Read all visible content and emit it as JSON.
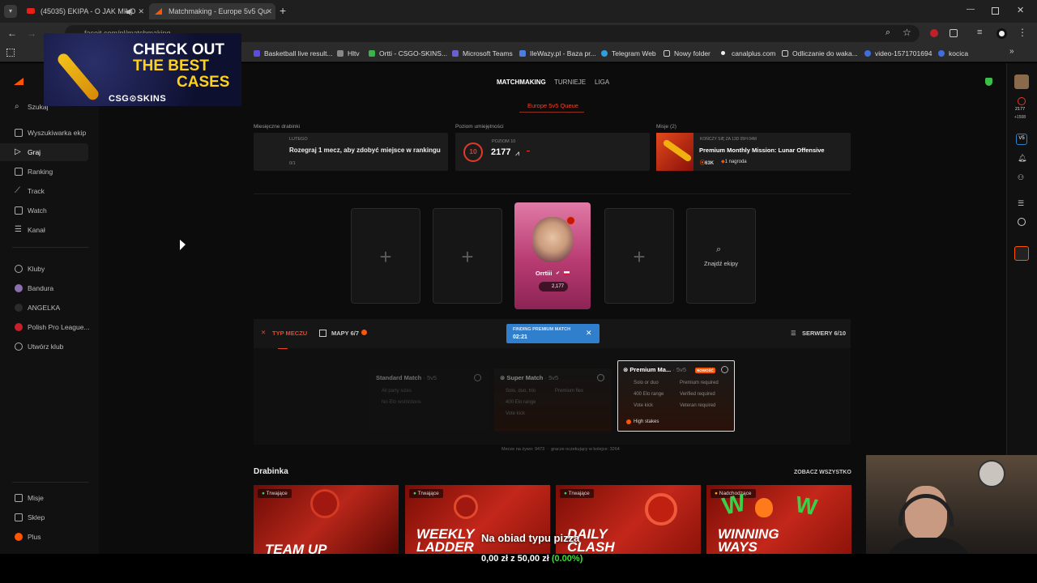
{
  "tabs": [
    {
      "label": "(45035) EKIPA - O JAK MIŁO"
    },
    {
      "label": "Matchmaking - Europe 5v5 Qu"
    }
  ],
  "address": "faceit.com/pl/matchmaking",
  "bookmarks": [
    "Basketball live result...",
    "Hltv",
    "Ortti - CSGO-SKINS...",
    "Microsoft Teams",
    "IleWazy.pl - Baza pr...",
    "Telegram Web",
    "Nowy folder",
    "canalplus.com",
    "Odliczanie do waka...",
    "video-1571701694",
    "kocica"
  ],
  "ad": {
    "line1": "CHECK OUT",
    "line2": "THE BEST",
    "line3": "CASES",
    "brand": "CSG⊙SKINS"
  },
  "nav": {
    "search": "Szukaj",
    "items": [
      "Wyszukiwarka ekip",
      "Graj",
      "Ranking",
      "Track",
      "Watch",
      "Kanał"
    ],
    "clubs": [
      "Kluby",
      "Bandura",
      "ANGELKA",
      "Polish Pro League...",
      "Utwórz klub"
    ],
    "bottom": [
      "Misje",
      "Sklep",
      "Plus"
    ]
  },
  "topnav": {
    "tabs": [
      "MATCHMAKING",
      "TURNIEJE",
      "LIGA"
    ],
    "queue": "Europe 5v5 Queue"
  },
  "cards": {
    "ladder": {
      "header": "Miesięczne drabinki",
      "sub": "LUTEGO",
      "title": "Rozegraj 1 mecz, aby zdobyć miejsce w rankingu",
      "progress": "0/1"
    },
    "skill": {
      "header": "Poziom umiejętności",
      "level_label": "POZIOM 10",
      "level": "10",
      "elo": "2177"
    },
    "mission": {
      "header": "Misje (2)",
      "sub": "KOŃCZY SIĘ ZA 13D 05H 04M",
      "title": "Premium Monthly Mission: Lunar Offensive",
      "points": "63K",
      "reward": "1 nagroda"
    }
  },
  "lobby": {
    "player_name": "Orrtiii",
    "player_elo": "2,177",
    "find_teams": "Znajdź ekipy"
  },
  "options": {
    "match_type": "TYP MECZU",
    "maps": "MAPY 6/7",
    "servers": "SERWERY 6/10",
    "finding_label": "FINDING PREMIUM MATCH",
    "finding_time": "02:21"
  },
  "modes": [
    {
      "title": "Standard Match",
      "tag": "5v5",
      "features": [
        "All party sizes",
        "No Elo restrictions"
      ]
    },
    {
      "title": "Super Match",
      "tag": "5v5",
      "features": [
        "Solo, duo, trio",
        "Premium flex",
        "400 Elo range",
        "Vote kick"
      ]
    },
    {
      "title": "Premium Ma...",
      "tag": "5v5",
      "badge": "NOWOŚĆ",
      "features": [
        "Solo or duo",
        "Premium required",
        "400 Elo range",
        "Verified required",
        "Vote kick",
        "Veteran required"
      ],
      "highlight": "High stakes"
    }
  ],
  "stats": "Mecze na żywo: 9473  ·  gracze oczekujący w kolejce: 3264",
  "drabinka": {
    "title": "Drabinka",
    "see_all": "ZOBACZ WSZYSTKO",
    "items": [
      {
        "tag": "Trwające",
        "title": "TEAM UP"
      },
      {
        "tag": "Trwające",
        "title": "WEEKLY LADDER"
      },
      {
        "tag": "Trwające",
        "title": "DAILY CLASH"
      },
      {
        "tag": "Nadchodzące",
        "title": "WINNING WAYS"
      }
    ]
  },
  "rightbar": {
    "elo": "2177",
    "elo_delta": "+1508"
  },
  "overlay": {
    "caption": "Na obiad typu pizza",
    "donation_amount": "0,00 zł z 50,00 zł",
    "donation_pct": "(0.00%)"
  }
}
